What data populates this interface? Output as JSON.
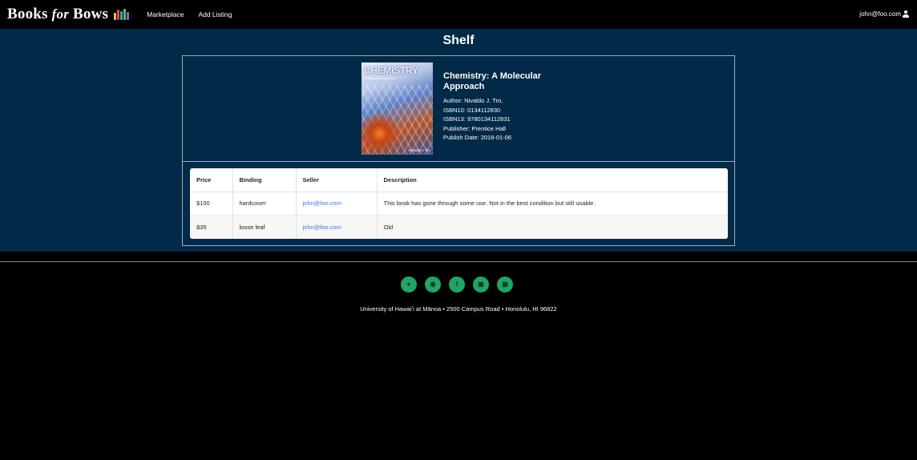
{
  "navbar": {
    "brand_books": "Books",
    "brand_for": "for",
    "brand_bows": "Bows",
    "links": [
      "Marketplace",
      "Add Listing"
    ],
    "user": "john@foo.com"
  },
  "main": {
    "title": "Shelf",
    "book": {
      "cover_title": "CHEMISTRY",
      "cover_subtitle": "A Molecular Approach",
      "cover_author": "Nivaldo J. Tro",
      "title": "Chemistry: A Molecular Approach",
      "author": "Author: Nivaldo J. Tro,",
      "isbn10": "ISBN10: 0134112830",
      "isbn13": "ISBN13: 9780134112831",
      "publisher": "Publisher: Prentice Hall",
      "publish_date": "Publish Date: 2016-01-06"
    },
    "table": {
      "headers": [
        "Price",
        "Binding",
        "Seller",
        "Description"
      ],
      "rows": [
        {
          "price": "$100",
          "binding": "hardcover",
          "seller": "john@foo.com",
          "description": "This book has gone through some use. Not in the best condition but still usable."
        },
        {
          "price": "$35",
          "binding": "loose leaf",
          "seller": "john@foo.com",
          "description": "Old"
        }
      ]
    }
  },
  "footer": {
    "socials": [
      "github-icon",
      "instagram-icon",
      "facebook-icon",
      "chat-icon",
      "linkedin-icon"
    ],
    "address": "University of Hawaiʻi at Mānoa • 2500 Campus Road • Honolulu, HI 96822"
  },
  "colors": {
    "main_bg": "#012a48",
    "social_green": "#21a466",
    "link_blue": "#3d7bd4"
  }
}
